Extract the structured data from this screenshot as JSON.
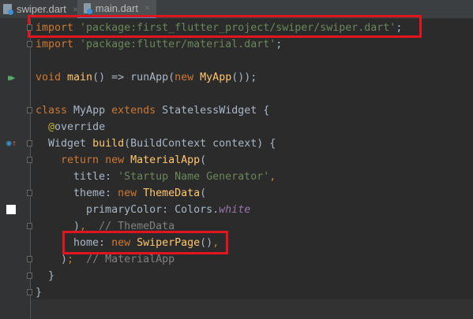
{
  "tabs": [
    {
      "label": "swiper.dart",
      "active": false
    },
    {
      "label": "main.dart",
      "active": true
    }
  ],
  "close_icon": "×",
  "colors": {
    "keyword": "#cc7832",
    "string": "#6a8759",
    "class": "#ffc66d",
    "comment": "#808080",
    "highlight": "#e0151e"
  },
  "code": [
    [
      [
        "kw",
        "import "
      ],
      [
        "str",
        "'package:first_flutter_project/swiper/swiper.dart'"
      ],
      [
        "",
        "; "
      ]
    ],
    [
      [
        "kw",
        "import "
      ],
      [
        "str",
        "'package:flutter/material.dart'"
      ],
      [
        "",
        ";"
      ]
    ],
    [],
    [
      [
        "kw",
        "void "
      ],
      [
        "fn",
        "main"
      ],
      [
        "",
        "() => runApp("
      ],
      [
        "kw",
        "new "
      ],
      [
        "cls",
        "MyApp"
      ],
      [
        "",
        "());"
      ]
    ],
    [],
    [
      [
        "kw",
        "class "
      ],
      [
        "",
        "MyApp "
      ],
      [
        "kw",
        "extends "
      ],
      [
        "",
        "StatelessWidget {"
      ]
    ],
    [
      [
        "",
        "  "
      ],
      [
        "ann",
        "@"
      ],
      [
        "",
        "override"
      ]
    ],
    [
      [
        "",
        "  Widget "
      ],
      [
        "fn",
        "build"
      ],
      [
        "",
        "(BuildContext context) {"
      ]
    ],
    [
      [
        "",
        "    "
      ],
      [
        "kw",
        "return new "
      ],
      [
        "cls",
        "MaterialApp"
      ],
      [
        "",
        "("
      ]
    ],
    [
      [
        "",
        "      title: "
      ],
      [
        "str",
        "'Startup Name Generator'"
      ],
      [
        "kw",
        ","
      ]
    ],
    [
      [
        "",
        "      theme: "
      ],
      [
        "kw",
        "new "
      ],
      [
        "cls",
        "ThemeData"
      ],
      [
        "",
        "("
      ]
    ],
    [
      [
        "",
        "        primaryColor: Colors."
      ],
      [
        "fld",
        "white"
      ]
    ],
    [
      [
        "",
        "      )"
      ],
      [
        "kw",
        ","
      ],
      [
        "",
        "  "
      ],
      [
        "cm",
        "// ThemeData"
      ]
    ],
    [
      [
        "",
        "      home: "
      ],
      [
        "kw",
        "new "
      ],
      [
        "cls",
        "SwiperPage"
      ],
      [
        "",
        "()"
      ],
      [
        "kw",
        ","
      ]
    ],
    [
      [
        "",
        "    )"
      ],
      [
        "kw",
        ";"
      ],
      [
        "",
        "  "
      ],
      [
        "cm",
        "// MaterialApp"
      ]
    ],
    [
      [
        "",
        "  }"
      ]
    ],
    [
      [
        "",
        "}"
      ]
    ]
  ],
  "gutter_icons": [
    "run-icon",
    "override-icon",
    "color-swatch-icon"
  ]
}
